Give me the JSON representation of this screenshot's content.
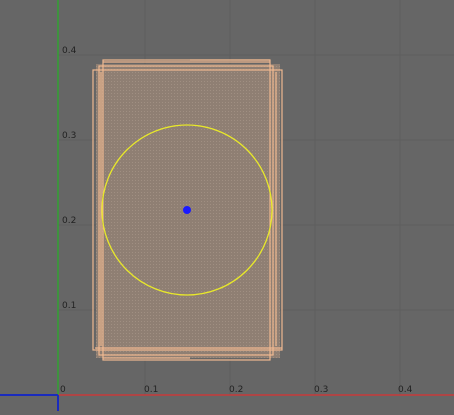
{
  "viewport": {
    "background": "#666666",
    "grid_color": "#5e5e5e",
    "x_axis_color": "#c73a3a",
    "y_axis_color": "#2fa52f",
    "origin_label": "0",
    "x_ticks": [
      "0.1",
      "0.2",
      "0.3",
      "0.4"
    ],
    "y_ticks": [
      "0.4",
      "0.3",
      "0.2",
      "0.1"
    ]
  },
  "mesh": {
    "outline_color": "#f0b890",
    "fill_color": "#8f7f73"
  },
  "circle": {
    "color": "#e8e82a"
  },
  "center_point": {
    "color": "#1a1aff"
  },
  "corner_gizmo": {
    "color": "#1a2bbd"
  }
}
